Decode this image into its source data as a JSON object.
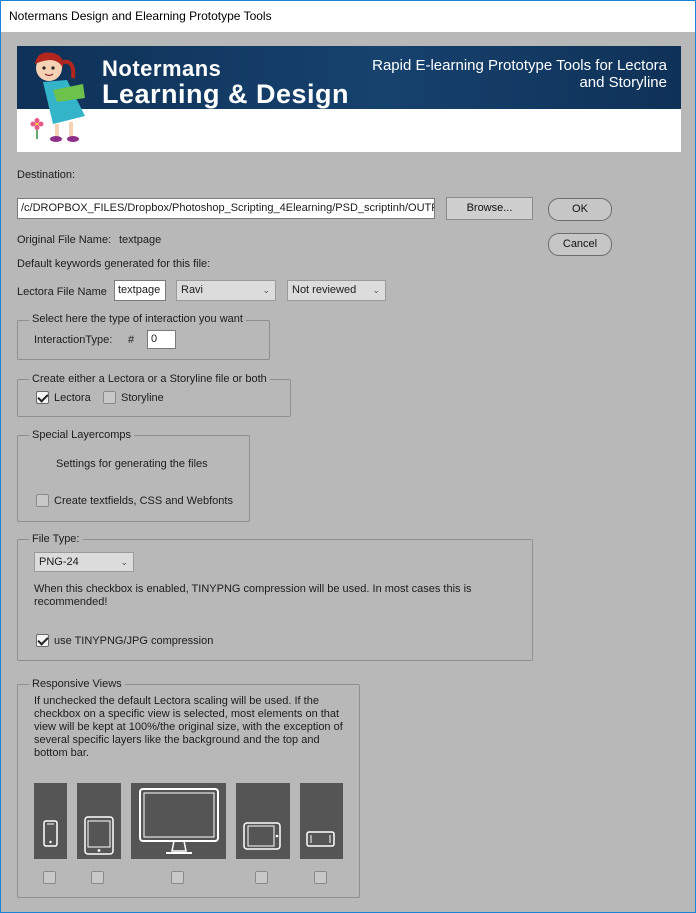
{
  "window": {
    "title": "Notermans Design and Elearning Prototype Tools"
  },
  "banner": {
    "logo_line1": "Notermans",
    "logo_line2": "Learning & Design",
    "tagline": "Rapid E-learning Prototype Tools for Lectora and Storyline"
  },
  "destination": {
    "label": "Destination:",
    "value": "/c/DROPBOX_FILES/Dropbox/Photoshop_Scripting_4Elearning/PSD_scriptinh/OUTPUT",
    "browse_label": "Browse..."
  },
  "actions": {
    "ok_label": "OK",
    "cancel_label": "Cancel"
  },
  "file": {
    "original_label": "Original File Name:",
    "original_value": "textpage",
    "keywords_label": "Default keywords generated for this file:",
    "lectora_label": "Lectora File Name",
    "lectora_value": "textpage",
    "author_select": "Ravi",
    "status_select": "Not reviewed"
  },
  "interaction": {
    "title": "Select here the type of interaction you want",
    "type_label": "InteractionType:",
    "hash": "#",
    "value": "0"
  },
  "output_kind": {
    "title": "Create either a Lectora or a Storyline file or both",
    "lectora_label": "Lectora",
    "lectora_checked": true,
    "storyline_label": "Storyline",
    "storyline_checked": false
  },
  "layercomps": {
    "title": "Special Layercomps",
    "subtitle": "Settings for generating the files",
    "textfields_label": "Create textfields, CSS and Webfonts",
    "textfields_checked": false
  },
  "file_type": {
    "title": "File Type:",
    "selected": "PNG-24",
    "note": "When this checkbox is enabled, TINYPNG compression will be used. In most cases this is recommended!",
    "tinypng_label": "use TINYPNG/JPG compression",
    "tinypng_checked": true
  },
  "responsive": {
    "title": "Responsive Views",
    "description": "If unchecked the default Lectora scaling will be used. If the checkbox on a specific view is selected, most elements on that view will be kept at 100%/the original size, with the exception of several specific layers like the background and the top and bottom bar.",
    "views": [
      {
        "icon": "phone-portrait-icon",
        "checked": false
      },
      {
        "icon": "tablet-portrait-icon",
        "checked": false
      },
      {
        "icon": "desktop-monitor-icon",
        "checked": false
      },
      {
        "icon": "tablet-landscape-icon",
        "checked": false
      },
      {
        "icon": "phone-landscape-icon",
        "checked": false
      }
    ]
  },
  "colors": {
    "dialog_bg": "#b8b8b8",
    "banner_bg": "#13365f",
    "device_tile": "#555555",
    "window_border": "#1883d7"
  }
}
